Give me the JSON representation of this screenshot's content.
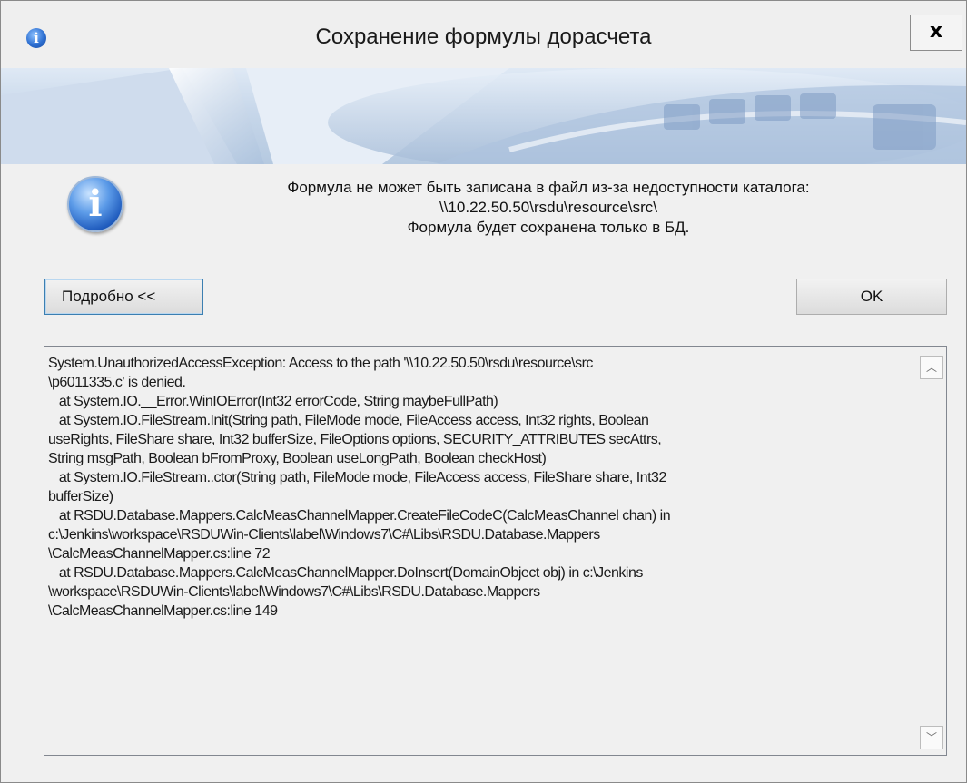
{
  "window": {
    "title": "Сохранение формулы дорасчета",
    "close_label": "x"
  },
  "message": {
    "line1": "Формула не может быть записана в файл из-за недоступности каталога:",
    "line2": "\\\\10.22.50.50\\rsdu\\resource\\src\\",
    "line3": "Формула будет сохранена только в БД."
  },
  "buttons": {
    "details_label": "Подробно <<",
    "ok_label": "OK"
  },
  "details": {
    "text": "System.UnauthorizedAccessException: Access to the path '\\\\10.22.50.50\\rsdu\\resource\\src\n\\p6011335.c' is denied.\n   at System.IO.__Error.WinIOError(Int32 errorCode, String maybeFullPath)\n   at System.IO.FileStream.Init(String path, FileMode mode, FileAccess access, Int32 rights, Boolean\nuseRights, FileShare share, Int32 bufferSize, FileOptions options, SECURITY_ATTRIBUTES secAttrs,\nString msgPath, Boolean bFromProxy, Boolean useLongPath, Boolean checkHost)\n   at System.IO.FileStream..ctor(String path, FileMode mode, FileAccess access, FileShare share, Int32\nbufferSize)\n   at RSDU.Database.Mappers.CalcMeasChannelMapper.CreateFileCodeC(CalcMeasChannel chan) in\nc:\\Jenkins\\workspace\\RSDUWin-Clients\\label\\Windows7\\C#\\Libs\\RSDU.Database.Mappers\n\\CalcMeasChannelMapper.cs:line 72\n   at RSDU.Database.Mappers.CalcMeasChannelMapper.DoInsert(DomainObject obj) in c:\\Jenkins\n\\workspace\\RSDUWin-Clients\\label\\Windows7\\C#\\Libs\\RSDU.Database.Mappers\n\\CalcMeasChannelMapper.cs:line 149"
  },
  "icons": {
    "title": "info-icon",
    "message": "info-icon",
    "close": "close-icon",
    "scroll_up": "chevron-up-icon",
    "scroll_down": "chevron-down-icon"
  },
  "scroll": {
    "up_glyph": "︿",
    "down_glyph": "﹀"
  },
  "colors": {
    "accent": "#2d6fd1",
    "focus_border": "#3c7fb1"
  }
}
